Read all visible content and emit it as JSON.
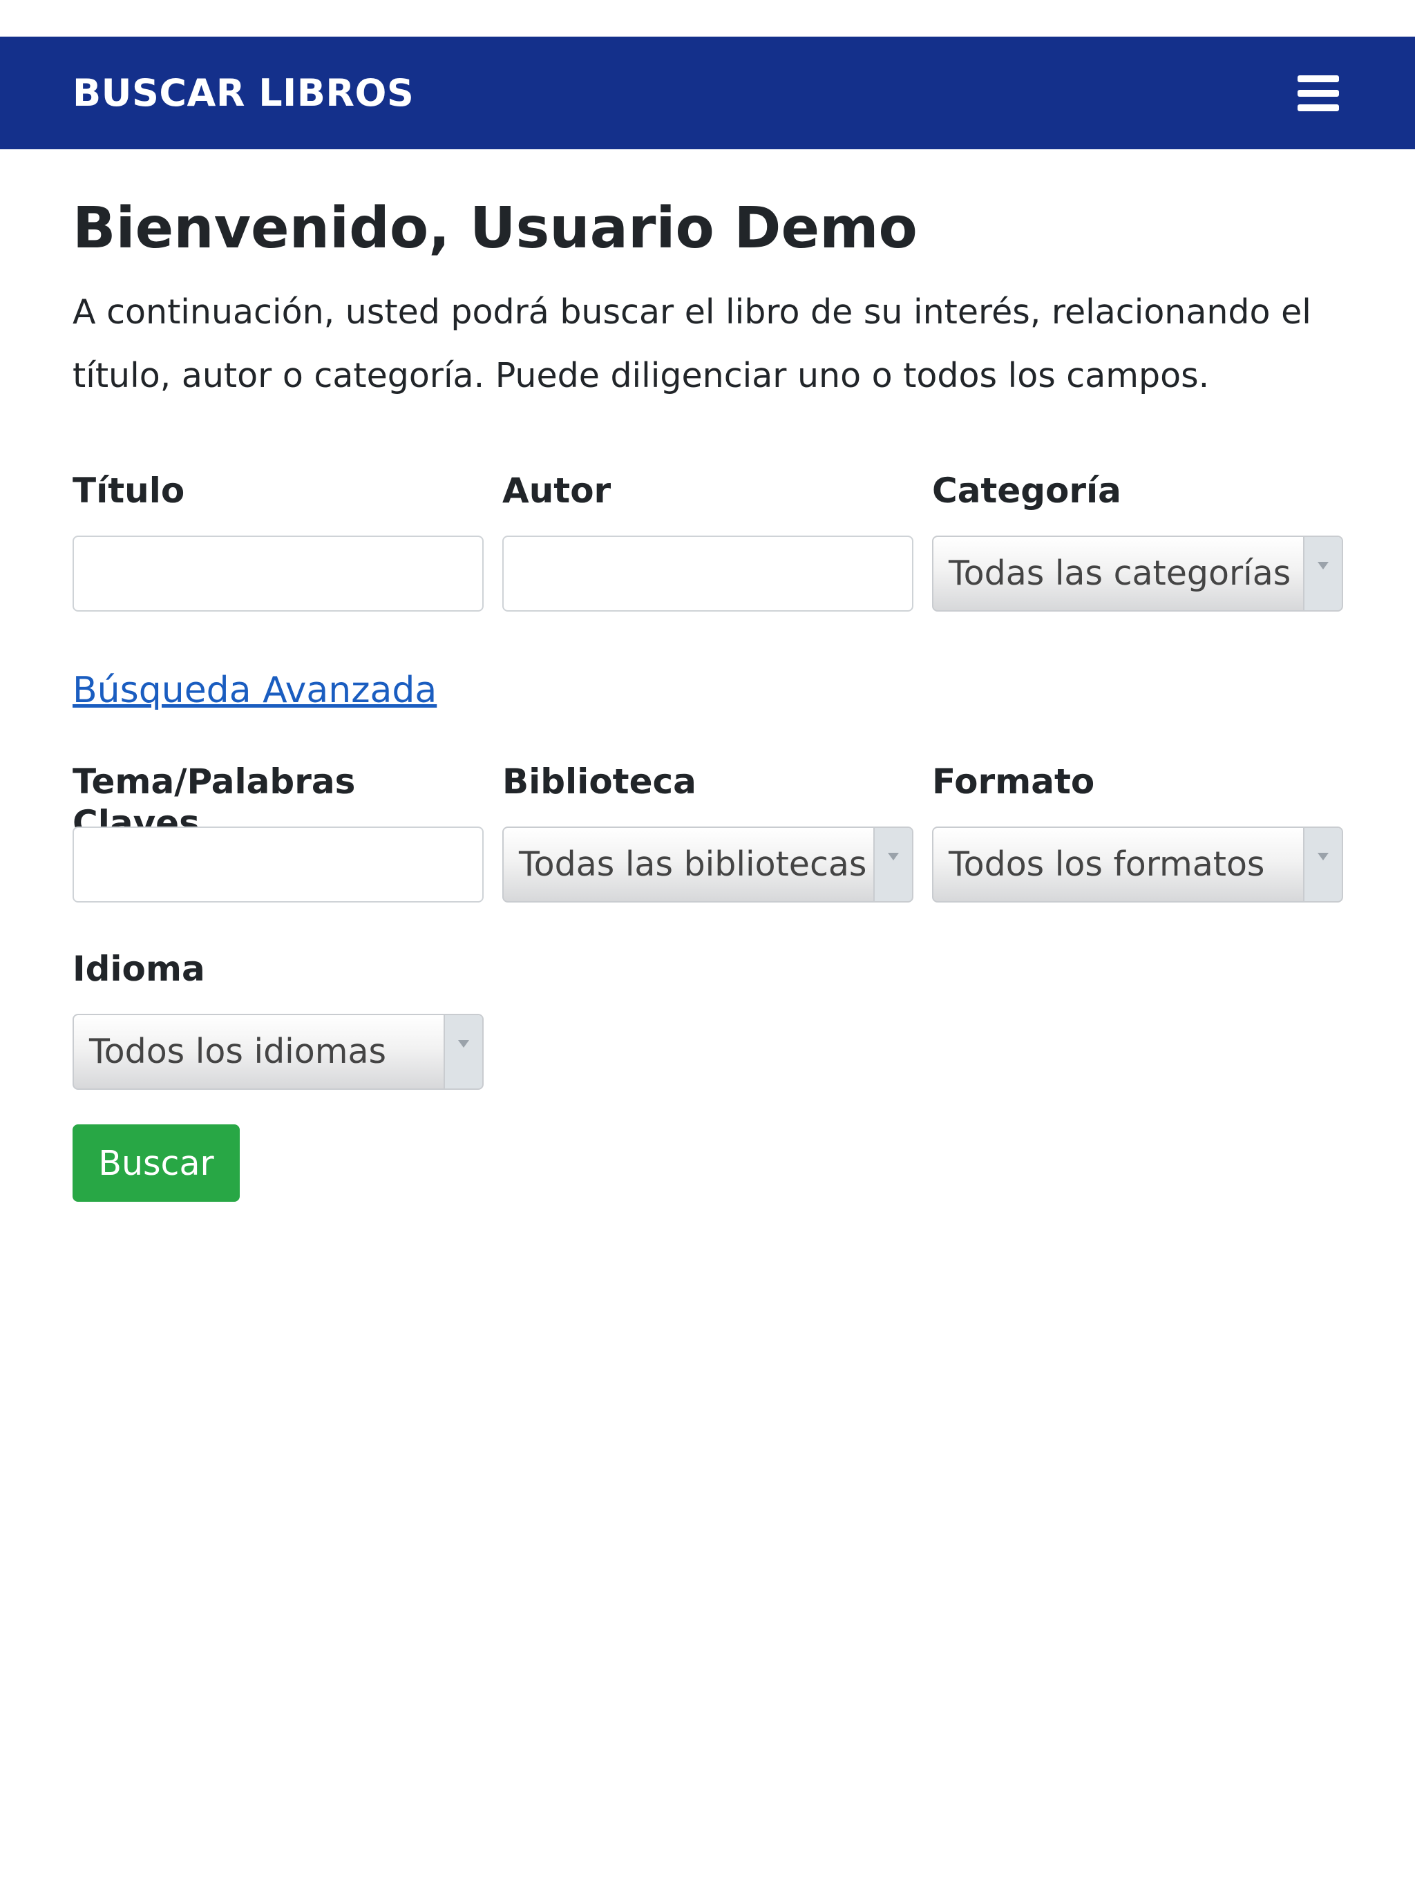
{
  "navbar": {
    "brand": "BUSCAR LIBROS",
    "menu_icon": "hamburger-menu-icon",
    "color": "#14308b"
  },
  "main": {
    "title": "Bienvenido, Usuario Demo",
    "intro_line1": "A continuación, usted podrá buscar el libro de su interés, relacionando el",
    "intro_line2": "título, autor o categoría. Puede diligenciar uno o todos los campos."
  },
  "form": {
    "titulo": {
      "label": "Título",
      "value": ""
    },
    "autor": {
      "label": "Autor",
      "value": ""
    },
    "categoria": {
      "label": "Categoría",
      "selected": "Todas las categorías"
    },
    "advanced_link": "Búsqueda Avanzada",
    "tema": {
      "label": "Tema/Palabras Claves",
      "value": ""
    },
    "biblioteca": {
      "label": "Biblioteca",
      "selected": "Todas las bibliotecas"
    },
    "formato": {
      "label": "Formato",
      "selected": "Todos los formatos"
    },
    "idioma": {
      "label": "Idioma",
      "selected": "Todos los idiomas"
    },
    "submit_label": "Buscar",
    "submit_color": "#28a745",
    "link_color": "#1a5dc0"
  }
}
